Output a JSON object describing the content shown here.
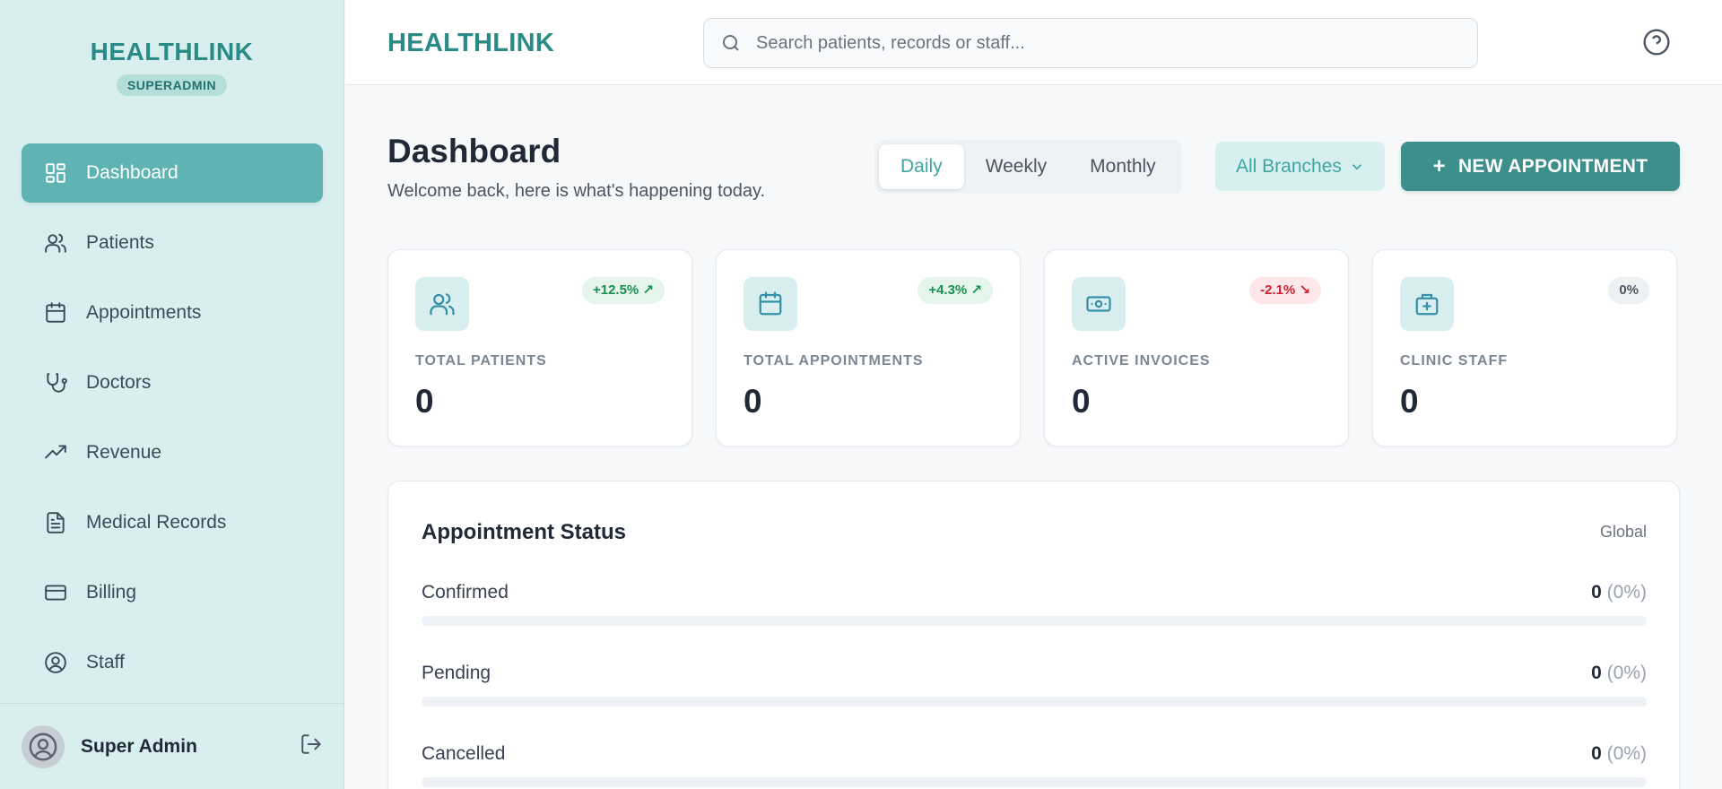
{
  "sidebar": {
    "brand": "HEALTHLINK",
    "role": "SUPERADMIN",
    "items": [
      {
        "label": "Dashboard",
        "icon": "grid-icon"
      },
      {
        "label": "Patients",
        "icon": "users-icon"
      },
      {
        "label": "Appointments",
        "icon": "calendar-icon"
      },
      {
        "label": "Doctors",
        "icon": "stethoscope-icon"
      },
      {
        "label": "Revenue",
        "icon": "trending-up-icon"
      },
      {
        "label": "Medical Records",
        "icon": "file-icon"
      },
      {
        "label": "Billing",
        "icon": "credit-card-icon"
      },
      {
        "label": "Staff",
        "icon": "user-circle-icon"
      }
    ],
    "active_item": "Dashboard",
    "user": {
      "name": "Super Admin"
    }
  },
  "topbar": {
    "brand": "HEALTHLINK",
    "search_placeholder": "Search patients, records or staff..."
  },
  "header": {
    "title": "Dashboard",
    "subtitle": "Welcome back, here is what's happening today.",
    "periods": [
      "Daily",
      "Weekly",
      "Monthly"
    ],
    "active_period": "Daily",
    "branch": "All Branches",
    "new_appointment_label": "NEW APPOINTMENT"
  },
  "stats": [
    {
      "label": "TOTAL PATIENTS",
      "value": "0",
      "trend": "+12.5% ↗",
      "trend_dir": "up",
      "icon": "users-icon"
    },
    {
      "label": "TOTAL APPOINTMENTS",
      "value": "0",
      "trend": "+4.3% ↗",
      "trend_dir": "up",
      "icon": "calendar-icon"
    },
    {
      "label": "ACTIVE INVOICES",
      "value": "0",
      "trend": "-2.1% ↘",
      "trend_dir": "down",
      "icon": "banknote-icon"
    },
    {
      "label": "CLINIC STAFF",
      "value": "0",
      "trend": "0%",
      "trend_dir": "flat",
      "icon": "medical-kit-icon"
    }
  ],
  "appointment_status": {
    "title": "Appointment Status",
    "scope": "Global",
    "rows": [
      {
        "label": "Confirmed",
        "count": "0",
        "percent": "(0%)",
        "fraction": 0
      },
      {
        "label": "Pending",
        "count": "0",
        "percent": "(0%)",
        "fraction": 0
      },
      {
        "label": "Cancelled",
        "count": "0",
        "percent": "(0%)",
        "fraction": 0
      }
    ]
  },
  "colors": {
    "brand": "#2a8a86",
    "accent": "#3ea6a3",
    "sidebar_bg": "#d9efef",
    "active_nav": "#5fb3b2",
    "primary_button": "#3d8f8c",
    "trend_up": "#1a8f4d",
    "trend_down": "#d11f2f"
  }
}
